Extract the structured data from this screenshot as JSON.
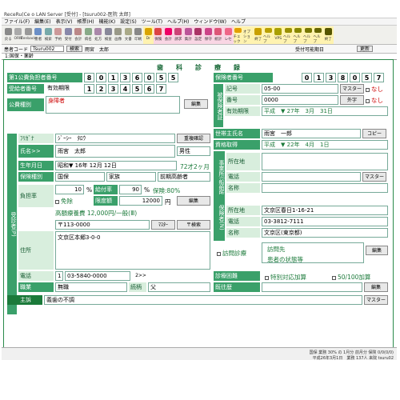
{
  "titlebar": {
    "text": "ReceRu(Ce o LAN Server [受付] - [tsuru002-医院 太郎]"
  },
  "menu": [
    "ファイル(F)",
    "編集(E)",
    "表示(V)",
    "帳票(H)",
    "機能(K)",
    "設定(S)",
    "ツール(T)",
    "ヘルプ(H)",
    "ウィンドウ(W)",
    "ヘルプ"
  ],
  "toolbar": [
    {
      "label": "戻る",
      "bg": "none"
    },
    {
      "label": "ORM",
      "bg": "none"
    },
    {
      "label": "Zenback",
      "bg": "none"
    },
    {
      "label": "患者",
      "bg": "none"
    },
    {
      "label": "検索",
      "bg": "none"
    },
    {
      "label": "予約",
      "bg": "none"
    },
    {
      "label": "受付",
      "bg": "none"
    },
    {
      "label": "会計",
      "bg": "none"
    },
    {
      "label": "病名",
      "bg": "none"
    },
    {
      "label": "処方",
      "bg": "none"
    },
    {
      "label": "検査",
      "bg": "none"
    },
    {
      "label": "画像",
      "bg": "none"
    },
    {
      "label": "文書",
      "bg": "none"
    },
    {
      "label": "印刷",
      "bg": "none"
    },
    {
      "label": "Dr",
      "bg": "yellow"
    },
    {
      "label": "保険",
      "bg": "pink"
    },
    {
      "label": "会計",
      "bg": "pink"
    },
    {
      "label": "請求",
      "bg": "pink"
    },
    {
      "label": "集計",
      "bg": "pink"
    },
    {
      "label": "設定",
      "bg": "pink"
    },
    {
      "label": "保守",
      "bg": "pink"
    },
    {
      "label": "統計",
      "bg": "pink"
    },
    {
      "label": "レセ",
      "bg": "pink"
    },
    {
      "label": "チェック",
      "bg": "yellow"
    },
    {
      "label": "オプション",
      "bg": "yellow"
    },
    {
      "label": "終了",
      "bg": "yellow"
    },
    {
      "label": "ヘルプ",
      "bg": "yellow"
    },
    {
      "label": "VPS",
      "bg": "yellow"
    },
    {
      "label": "ヘルプ",
      "bg": "yellow"
    },
    {
      "label": "ヘルプ",
      "bg": "yellow"
    },
    {
      "label": "ヘルプ",
      "bg": "yellow"
    },
    {
      "label": "ヘルプ",
      "bg": "yellow"
    },
    {
      "label": "終了",
      "bg": "yellow"
    }
  ],
  "infobar": {
    "code_label": "患者コード",
    "code_value": "Tsuru002",
    "search": "検索",
    "name": "雨宮　太郎",
    "status": "受付可能期日",
    "update": "更新"
  },
  "tab": "1:国保・薬齢",
  "form": {
    "title": "歯　科　診　療　録",
    "kohi1_label": "第1公費負担者番号",
    "kohi1_digits": [
      "8",
      "0",
      "1",
      "3",
      "6",
      "0",
      "5",
      "5"
    ],
    "jukyu_label": "受給者番号",
    "yuko_label": "有効期限",
    "jukyu_digits": [
      "1",
      "2",
      "3",
      "4",
      "5",
      "6",
      "7"
    ],
    "kohi_shubetsu_label": "公費種別",
    "kohi_shubetsu_value": "身障者",
    "edit": "編集",
    "hokensha_label": "保険者番号",
    "hokensha_digits": [
      "0",
      "1",
      "3",
      "8",
      "0",
      "5",
      "7"
    ],
    "hihoken_label": "被保険者証",
    "kigou_label": "記号",
    "kigou_value": "05-00",
    "master": "マスター",
    "nashi": "なし",
    "bango_label": "番号",
    "bango_value": "0000",
    "gaiji": "外字",
    "yuko2_label": "有効期限",
    "era": "平成",
    "y1": "27",
    "m1": "3",
    "d1": "31",
    "nen": "年",
    "tsuki": "月",
    "hi": "日",
    "setai_label": "世帯主氏名",
    "setai_value": "雨宮　一郎",
    "copy": "コピー",
    "shikaku_label": "資格取得",
    "era2": "平成",
    "y2": "22",
    "m2": "4",
    "d2": "1",
    "jigyosho_label": "事業所(船舶所有者)",
    "shozai_label": "所在地",
    "denwa_label": "電話",
    "meisho_label": "名称",
    "hokensha_side": "保険者(N)",
    "shozai2_value": "文京区春日1-16-21",
    "denwa2_value": "03-3812-7111",
    "meisho2_value": "文京区(東京都)",
    "jushin_side": "受診者(P)",
    "furigana_label": "ﾌﾘｶﾞﾅ",
    "furigana_value": "ｼﾞｰｼｰ　ﾀﾛｳ",
    "jucho": "重複確認",
    "shimei_label": "氏名>>",
    "shimei_value": "雨宮　太郎",
    "seibetsu": "男性",
    "birth_label": "生年月日",
    "birth_era": "昭和",
    "by": "16",
    "bm": "12",
    "bd": "12",
    "age": "72才2ヶ月",
    "hoken_shubetsu_label": "保険種別",
    "hs1": "国保",
    "hs2": "家族",
    "hs3": "前期高齢者",
    "futan_label": "負担率",
    "ratio1": "10",
    "pct": "%",
    "kyufu": "給付率",
    "ratio2": "90",
    "hoken": "保険:80%",
    "menjo": "免除",
    "gendo": "限度額",
    "gendo_value": "12000",
    "yen": "円",
    "kogaku": "高額療養費 12,000円/一般(Ⅲ)",
    "zip": "〒113-0000",
    "zip_master": "ﾏｽﾀｰ",
    "zip_search": "〒検索",
    "jusho_label": "住所",
    "jusho_value": "文京区本郷3-0-0",
    "homon_label": "訪問診療",
    "homon_saki": "訪問先",
    "jotai": "患者の状態等",
    "tel_label": "電話",
    "tel_no": "1",
    "tel_value": "03-5840-0000",
    "next": "2>>",
    "shokugyo_label": "職業",
    "shokugyo_value": "無職",
    "zokugara_label": "続柄",
    "zokugara_value": "父",
    "shindan_label": "診療困難",
    "tokubetsu": "特別対応加算",
    "kasan": "50/100加算",
    "kiou_label": "既往歴",
    "shuso_label": "主訴",
    "shuso_value": "義歯の不調",
    "master2": "マスター"
  },
  "status": {
    "line1": "国保 業務 30%  の 1月分   前月分 保険 0/0(0/0)",
    "line2": "平成26年3月1日　業務 137人 来院 tsuru02"
  }
}
